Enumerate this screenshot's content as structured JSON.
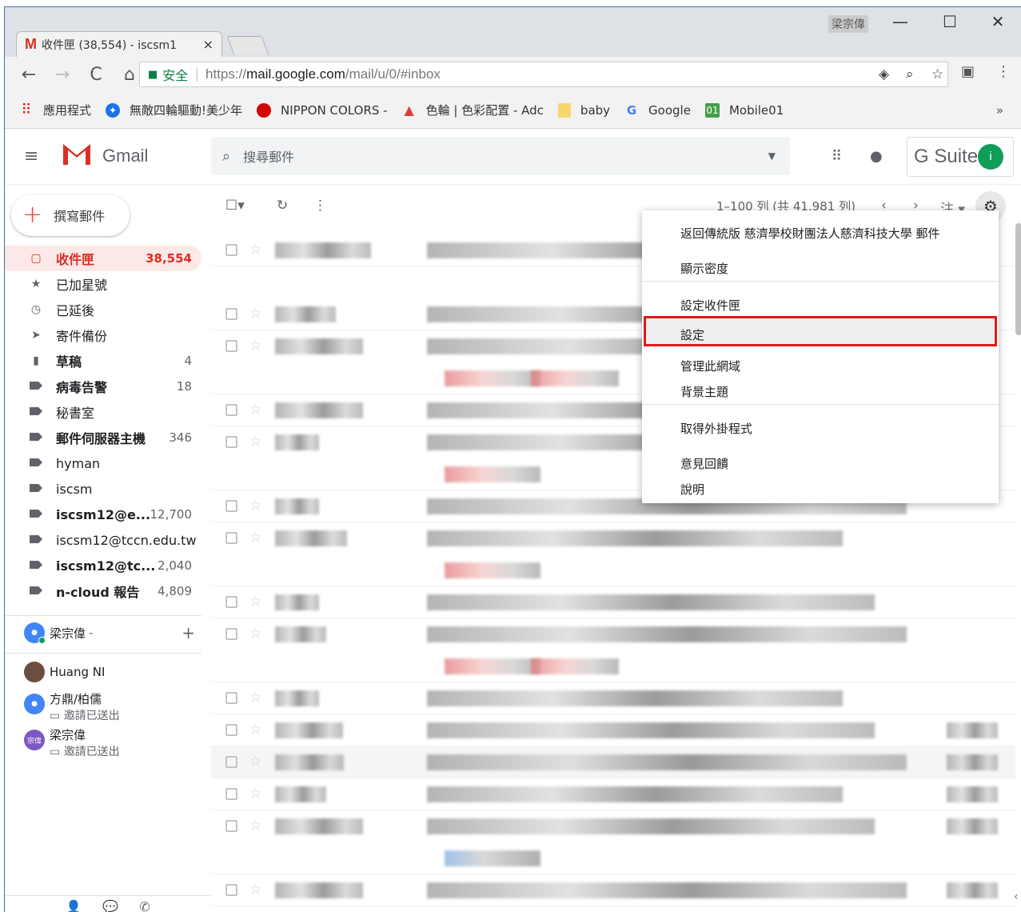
{
  "browser": {
    "tab_title": "收件匣 (38,554) - iscsm1",
    "tab_close": "×",
    "user": "梁宗偉",
    "win_min": "—",
    "win_max": "☐",
    "win_close": "✕",
    "secure_label": "安全",
    "url_prefix": "https://",
    "url_host": "mail.google.com",
    "url_path": "/mail/u/0/#inbox",
    "bookmarks": [
      "應用程式",
      "無敵四輪驅動!美少年",
      "NIPPON COLORS -",
      "色輪 | 色彩配置 - Adc",
      "baby",
      "Google",
      "Mobile01"
    ],
    "bookmarks_more": "»"
  },
  "gmail": {
    "logo_text": "Gmail",
    "search_placeholder": "搜尋郵件",
    "gsuite_text": "G Suite",
    "avatar_letter": "i",
    "compose_label": "撰寫郵件",
    "labels": [
      {
        "name": "收件匣",
        "count": "38,554"
      },
      {
        "name": "已加星號",
        "count": ""
      },
      {
        "name": "已延後",
        "count": ""
      },
      {
        "name": "寄件備份",
        "count": ""
      },
      {
        "name": "草稿",
        "count": "4"
      },
      {
        "name": "病毒告警",
        "count": "18"
      },
      {
        "name": "秘書室",
        "count": ""
      },
      {
        "name": "郵件伺服器主機",
        "count": "346"
      },
      {
        "name": "hyman",
        "count": ""
      },
      {
        "name": "iscsm",
        "count": ""
      },
      {
        "name": "iscsm12@e...",
        "count": "12,700"
      },
      {
        "name": "iscsm12@tccn.edu.tw",
        "count": ""
      },
      {
        "name": "iscsm12@tc...",
        "count": "2,040"
      },
      {
        "name": "n-cloud 報告",
        "count": "4,809"
      }
    ],
    "hangouts": {
      "me": "梁宗偉",
      "me_suffix": "-",
      "add": "+",
      "contacts": [
        {
          "name": "Huang NI",
          "status": ""
        },
        {
          "name": "方鼎/柏儒",
          "status": "邀請已送出"
        },
        {
          "name": "梁宗偉",
          "status": "邀請已送出",
          "avatar_text": "宗偉"
        }
      ]
    },
    "paging": "1–100 列 (共 41,981 列)",
    "notes_label": "注"
  },
  "settings_menu": {
    "items": [
      "返回傳統版 慈濟學校財團法人慈濟科技大學 郵件",
      "顯示密度",
      "設定收件匣",
      "設定",
      "管理此網域",
      "背景主題",
      "取得外掛程式",
      "意見回饋",
      "說明"
    ],
    "highlighted": "設定"
  },
  "colors": {
    "accent": "#d93025",
    "highlight_border": "#e01b1b",
    "secure": "#0b8043"
  },
  "icons": [
    "gmail-icon",
    "back-icon",
    "forward-icon",
    "reload-icon",
    "home-icon",
    "lock-icon",
    "eye-icon",
    "zoom-icon",
    "bookmark-star-icon",
    "extension-icon",
    "kebab-menu-icon",
    "hamburger-icon",
    "search-icon",
    "apps-grid-icon",
    "notification-icon",
    "gear-icon",
    "inbox-icon",
    "star-icon",
    "clock-icon",
    "send-icon",
    "draft-icon",
    "label-icon"
  ]
}
